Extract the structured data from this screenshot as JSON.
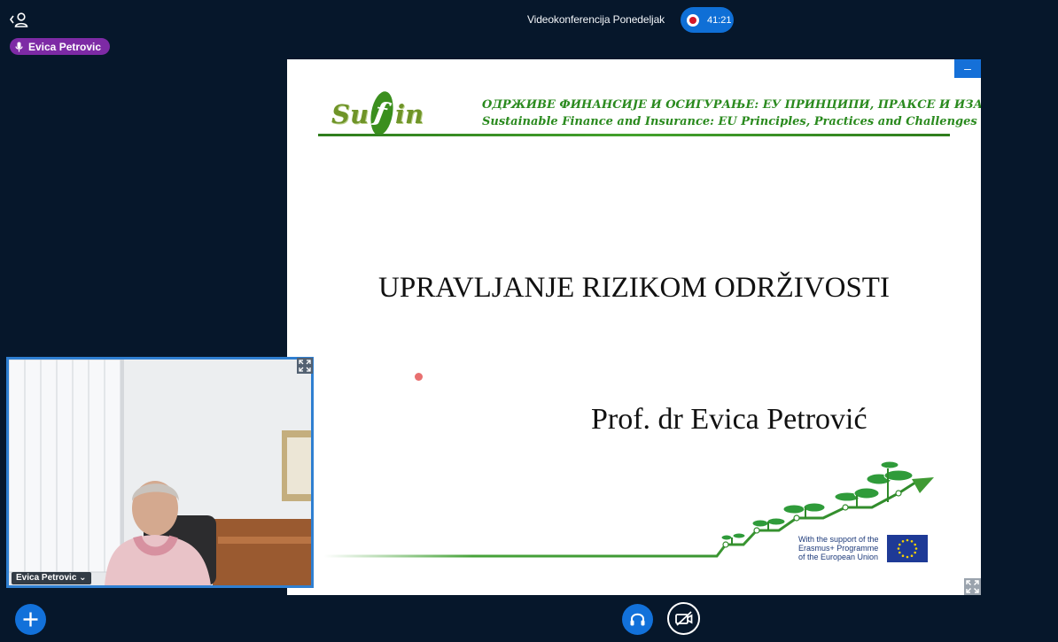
{
  "header": {
    "meeting_title": "Videokonferencija Ponedeljak",
    "recording_time": "41:21"
  },
  "talking_indicator": {
    "name": "Evica Petrovic"
  },
  "presentation": {
    "logo_text_left": "Su",
    "logo_text_f": "f",
    "logo_text_right": "in",
    "header_line_cyrillic": "ОДРЖИВЕ ФИНАНСИЈЕ И ОСИГУРАЊЕ: ЕУ ПРИНЦИПИ, ПРАКСЕ И ИЗАЗОВИ",
    "header_line_english": "Sustainable Finance and Insurance: EU Principles, Practices and Challenges",
    "title": "UPRAVLJANJE RIZIKOM ODRŽIVOSTI",
    "author": "Prof. dr Evica Petrović",
    "eu_support_line1": "With the support of the",
    "eu_support_line2": "Erasmus+ Programme",
    "eu_support_line3": "of the European Union",
    "minimize_glyph": "–"
  },
  "webcam": {
    "presenter_name": "Evica Petrovic",
    "dropdown_glyph": "⌄"
  },
  "colors": {
    "background": "#06172b",
    "accent_blue": "#1271da",
    "talking_purple": "#7d2aa5",
    "slide_green": "#2a8a1e",
    "recording_red": "#d3182a"
  }
}
